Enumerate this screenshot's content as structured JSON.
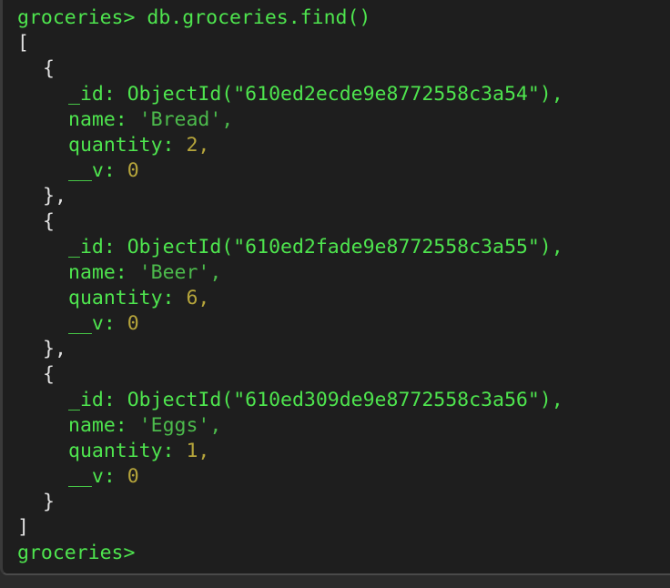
{
  "terminal": {
    "prompt": "groceries>",
    "command": "db.groceries.find()",
    "open_bracket": "[",
    "close_bracket": "]",
    "open_brace": "{",
    "close_brace": "}",
    "close_brace_comma": "},",
    "documents": [
      {
        "id_key": "_id:",
        "id_value": "ObjectId(\"610ed2ecde9e8772558c3a54\"),",
        "name_key": "name:",
        "name_value": "'Bread',",
        "quantity_key": "quantity:",
        "quantity_value": "2,",
        "v_key": "__v:",
        "v_value": "0"
      },
      {
        "id_key": "_id:",
        "id_value": "ObjectId(\"610ed2fade9e8772558c3a55\"),",
        "name_key": "name:",
        "name_value": "'Beer',",
        "quantity_key": "quantity:",
        "quantity_value": "6,",
        "v_key": "__v:",
        "v_value": "0"
      },
      {
        "id_key": "_id:",
        "id_value": "ObjectId(\"610ed309de9e8772558c3a56\"),",
        "name_key": "name:",
        "name_value": "'Eggs',",
        "quantity_key": "quantity:",
        "quantity_value": "1,",
        "v_key": "__v:",
        "v_value": "0"
      }
    ]
  }
}
